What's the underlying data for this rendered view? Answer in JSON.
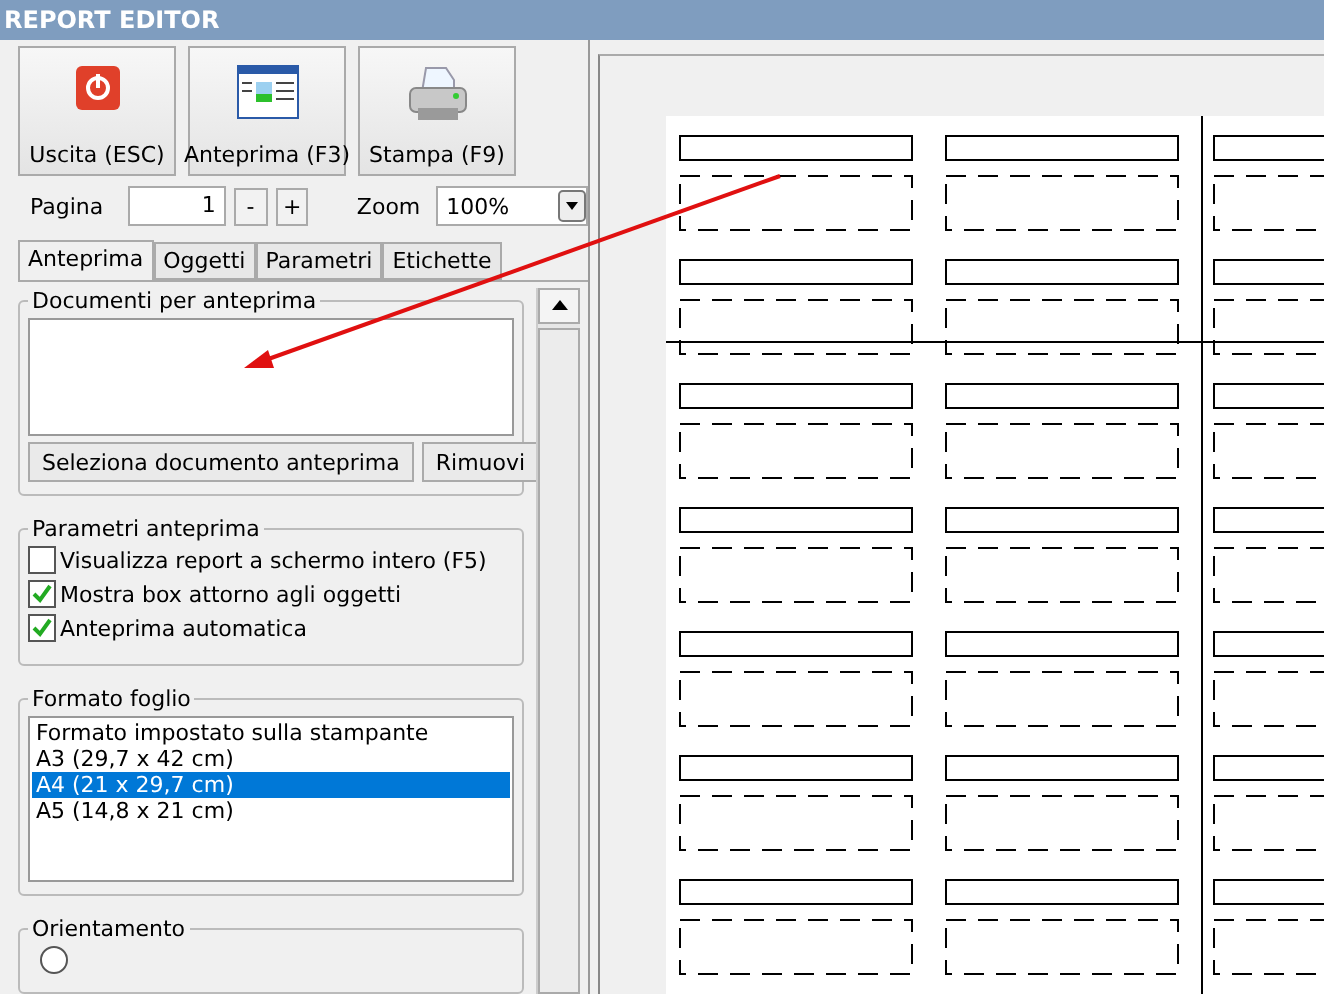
{
  "window": {
    "title": "REPORT EDITOR"
  },
  "toolbar": [
    {
      "kind": "exit",
      "label": "Uscita (ESC)"
    },
    {
      "kind": "preview",
      "label": "Anteprima (F3)"
    },
    {
      "kind": "print",
      "label": "Stampa (F9)"
    }
  ],
  "page_nav": {
    "label": "Pagina",
    "value": "1",
    "minus": "-",
    "plus": "+"
  },
  "zoom": {
    "label": "Zoom",
    "value": "100%"
  },
  "tabs": [
    {
      "label": "Anteprima",
      "selected": true
    },
    {
      "label": "Oggetti",
      "selected": false
    },
    {
      "label": "Parametri",
      "selected": false
    },
    {
      "label": "Etichette",
      "selected": false
    }
  ],
  "documents": {
    "title": "Documenti per anteprima",
    "buttons": [
      "Seleziona documento anteprima",
      "Rimuovi"
    ]
  },
  "preview_params": {
    "title": "Parametri anteprima",
    "options": [
      {
        "label": "Visualizza report a schermo intero (F5)",
        "checked": false
      },
      {
        "label": "Mostra box attorno agli oggetti",
        "checked": true
      },
      {
        "label": "Anteprima automatica",
        "checked": true
      }
    ]
  },
  "sheet_format": {
    "title": "Formato foglio",
    "items": [
      {
        "label": "Formato impostato sulla stampante",
        "selected": false
      },
      {
        "label": "A3 (29,7 x 42 cm)",
        "selected": false
      },
      {
        "label": "A4 (21 x 29,7 cm)",
        "selected": true
      },
      {
        "label": "A5 (14,8 x 21 cm)",
        "selected": false
      }
    ]
  },
  "orientation": {
    "title": "Orientamento",
    "options": [
      {
        "selected": false
      }
    ]
  }
}
